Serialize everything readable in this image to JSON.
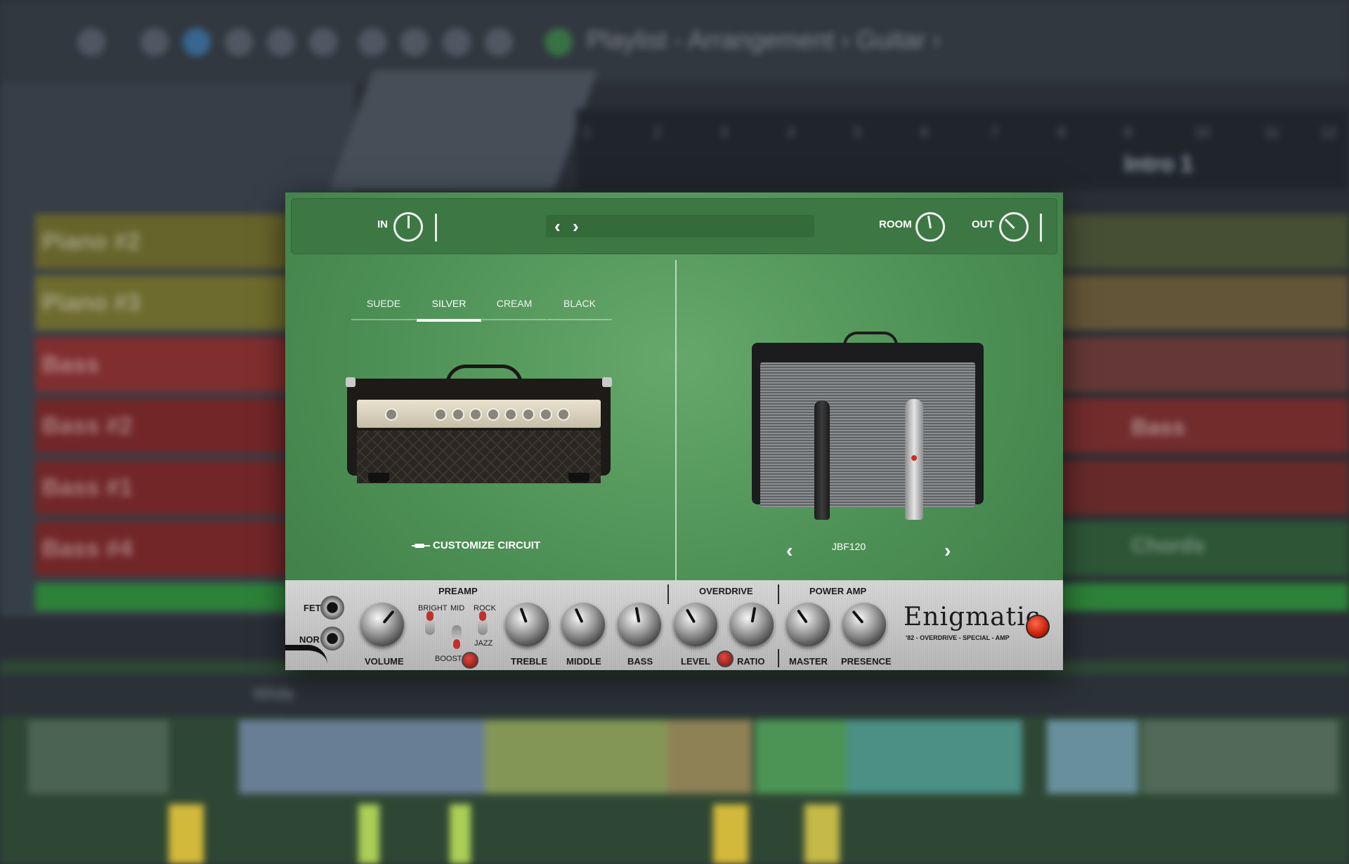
{
  "daw": {
    "title": "Playlist - Arrangement › Guitar ›",
    "tracks": [
      {
        "label": "Piano #2",
        "color": "#6e6a2a"
      },
      {
        "label": "Piano #3",
        "color": "#76722e"
      },
      {
        "label": "Bass",
        "color": "#8a2e2e"
      },
      {
        "label": "Bass #2",
        "color": "#7a2626"
      },
      {
        "label": "Bass #1",
        "color": "#7a2626"
      },
      {
        "label": "Bass #4",
        "color": "#7a2626"
      }
    ],
    "ruler": [
      "1",
      "2",
      "3",
      "4",
      "5",
      "6",
      "7",
      "8",
      "9",
      "10",
      "11",
      "12"
    ],
    "pattern_label": "Bass",
    "chords_label": "Chords",
    "marker": "Intro 1",
    "wide": "Wide"
  },
  "plugin": {
    "topbar": {
      "in_label": "IN",
      "room_label": "ROOM",
      "out_label": "OUT",
      "prev_preset": "‹",
      "next_preset": "›"
    },
    "amp_tabs": [
      {
        "label": "SUEDE",
        "active": false
      },
      {
        "label": "SILVER",
        "active": true
      },
      {
        "label": "CREAM",
        "active": false
      },
      {
        "label": "BLACK",
        "active": false
      }
    ],
    "customize_label": "CUSTOMIZE CIRCUIT",
    "cabinet": {
      "name": "JBF120",
      "prev": "‹",
      "next": "›"
    },
    "controls": {
      "fet_label": "FET",
      "nor_label": "NOR",
      "preamp_label": "PREAMP",
      "overdrive_label": "OVERDRIVE",
      "power_amp_label": "POWER AMP",
      "bright_label": "BRIGHT",
      "mid_label": "MID",
      "rock_label": "ROCK",
      "jazz_label": "JAZZ",
      "boost_label": "BOOST",
      "knobs": {
        "volume": "VOLUME",
        "treble": "TREBLE",
        "middle": "MIDDLE",
        "bass": "BASS",
        "level": "LEVEL",
        "ratio": "RATIO",
        "master": "MASTER",
        "presence": "PRESENCE"
      }
    },
    "brand": {
      "name": "Enigmatic",
      "tagline": "'82 - OVERDRIVE - SPECIAL - AMP"
    }
  }
}
